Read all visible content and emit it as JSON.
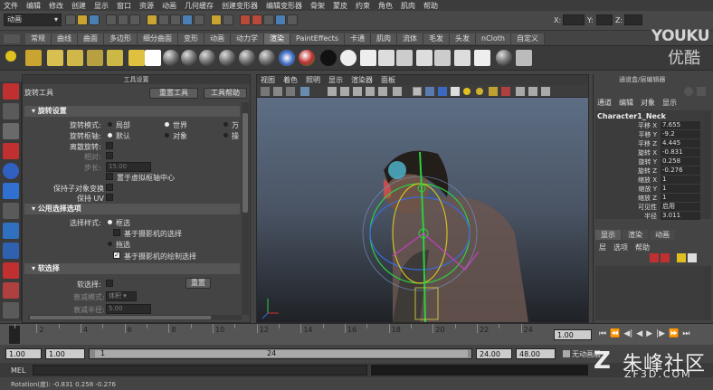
{
  "menubar": [
    "文件",
    "编辑",
    "修改",
    "创建",
    "显示",
    "窗口",
    "资源",
    "动画",
    "几何缓存",
    "创建变形器",
    "编辑变形器",
    "骨架",
    "蒙皮",
    "约束",
    "角色",
    "肌肉",
    "帮助"
  ],
  "status": {
    "mode": "动画",
    "x_label": "X:",
    "y_label": "Y:",
    "z_label": "Z:"
  },
  "shelf_tabs": [
    "常规",
    "曲线",
    "曲面",
    "多边形",
    "细分曲面",
    "变形",
    "动画",
    "动力学",
    "渲染",
    "PaintEffects",
    "卡通",
    "肌肉",
    "流体",
    "毛发",
    "头发",
    "nCloth",
    "自定义"
  ],
  "shelf_active": "渲染",
  "tool_settings": {
    "panel_title": "工具设置",
    "tool_name": "旋转工具",
    "reset_button": "重置工具",
    "help_button": "工具帮助",
    "section_rotate": "旋转设置",
    "rotate_mode_label": "旋转模式:",
    "rotate_mode_options": [
      "局部",
      "世界",
      "万"
    ],
    "rotate_axis_label": "旋转枢轴:",
    "rotate_axis_options": [
      "默认",
      "对象",
      "操"
    ],
    "discrete_label": "离散旋转:",
    "relative_label": "相对:",
    "step_label": "步长:",
    "step_value": "15.00",
    "center_option": "置于虚拟枢轴中心",
    "preserve_child_label": "保持子对象变换",
    "preserve_uv_label": "保持 UV",
    "section_common": "公用选择选项",
    "select_style_label": "选择样式:",
    "marquee_option": "框选",
    "camera_based_option": "基于摄影机的选择",
    "drag_option": "拖选",
    "camera_paint_option": "基于摄影机的绘制选择",
    "section_soft": "软选择",
    "soft_select_label": "软选择:",
    "reset_soft": "重置",
    "falloff_mode_label": "衰减模式:",
    "falloff_mode_value": "体积",
    "falloff_radius_label": "衰减半径:",
    "falloff_radius_value": "5.00"
  },
  "viewport": {
    "menu": [
      "视图",
      "着色",
      "照明",
      "显示",
      "渲染器",
      "面板"
    ]
  },
  "channel_box": {
    "title": "通道盒/层编辑器",
    "menu": [
      "通道",
      "编辑",
      "对象",
      "显示"
    ],
    "object": "Character1_Neck",
    "rows": [
      {
        "k": "平移 X",
        "v": "7.655"
      },
      {
        "k": "平移 Y",
        "v": "-9.2"
      },
      {
        "k": "平移 Z",
        "v": "4.445"
      },
      {
        "k": "旋转 X",
        "v": "-0.831"
      },
      {
        "k": "旋转 Y",
        "v": "0.258"
      },
      {
        "k": "旋转 Z",
        "v": "-0.276"
      },
      {
        "k": "缩放 X",
        "v": "1"
      },
      {
        "k": "缩放 Y",
        "v": "1"
      },
      {
        "k": "缩放 Z",
        "v": "1"
      },
      {
        "k": "可见性",
        "v": "启用"
      },
      {
        "k": "半径",
        "v": "3.011"
      }
    ],
    "layer_tabs": [
      "显示",
      "渲染",
      "动画"
    ],
    "layer_menu": [
      "层",
      "选项",
      "帮助"
    ]
  },
  "timeline": {
    "ticks": [
      "2",
      "4",
      "6",
      "8",
      "10",
      "12",
      "14",
      "16",
      "18",
      "20",
      "22",
      "24"
    ],
    "current_frame": "1.00"
  },
  "range": {
    "start": "1.00",
    "start2": "1.00",
    "slider_start": "1",
    "slider_end": "24",
    "end": "24.00",
    "end2": "48.00",
    "anim_layer": "无动画层"
  },
  "mel_label": "MEL",
  "help_line": "Rotation(度):  -0.831     0.258     -0.276",
  "watermarks": {
    "youku": "YOUKU",
    "youku_cn": "优酷",
    "zf": "Z",
    "zf_cn": "朱峰社区",
    "zf_url": "ZF3D.COM"
  }
}
